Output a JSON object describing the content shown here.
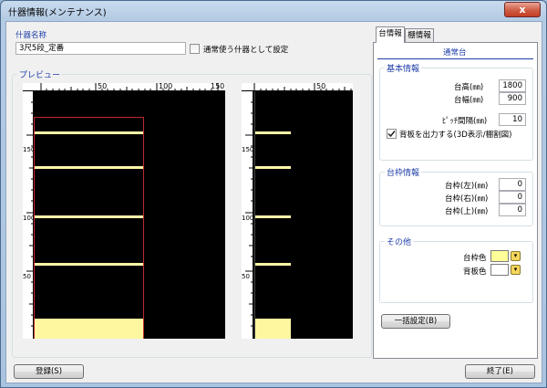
{
  "window": {
    "title": "什器情報(メンテナンス)",
    "close_label": "x"
  },
  "fixture": {
    "name_label": "什器名称",
    "name_value": "3尺5段_定番",
    "frequent_checkbox_label": "通常使う什器として設定",
    "frequent_checked": false
  },
  "preview": {
    "label": "プレビュー",
    "main_ruler_top_ticks": [
      "50",
      "100",
      "150"
    ],
    "main_ruler_left_ticks": [
      "150",
      "100",
      "50"
    ],
    "side_ruler_top_ticks": [
      "50"
    ],
    "side_ruler_left_ticks": [
      "150",
      "100",
      "50"
    ]
  },
  "tabs": [
    {
      "label": "台情報",
      "active": true
    },
    {
      "label": "棚情報",
      "active": false
    }
  ],
  "panel": {
    "mode_title": "通常台",
    "basic": {
      "title": "基本情報",
      "height_label": "台高(㎜)",
      "height_value": "1800",
      "width_label": "台幅(㎜)",
      "width_value": "900",
      "pitch_label": "ﾋﾟｯﾁ間隔(㎜)",
      "pitch_value": "10",
      "backboard_label": "背板を出力する(3D表示/棚割図)",
      "backboard_checked": true
    },
    "frame": {
      "title": "台枠情報",
      "left_label": "台枠(左)(㎜)",
      "left_value": "0",
      "right_label": "台枠(右)(㎜)",
      "right_value": "0",
      "top_label": "台枠(上)(㎜)",
      "top_value": "0"
    },
    "other": {
      "title": "その他",
      "frame_color_label": "台枠色",
      "frame_color": "#ffff99",
      "backboard_color_label": "背板色",
      "backboard_color": "#ffffff"
    },
    "bulk_button": "一括設定(B)"
  },
  "footer": {
    "register_button": "登録(S)",
    "exit_button": "終了(E)"
  }
}
